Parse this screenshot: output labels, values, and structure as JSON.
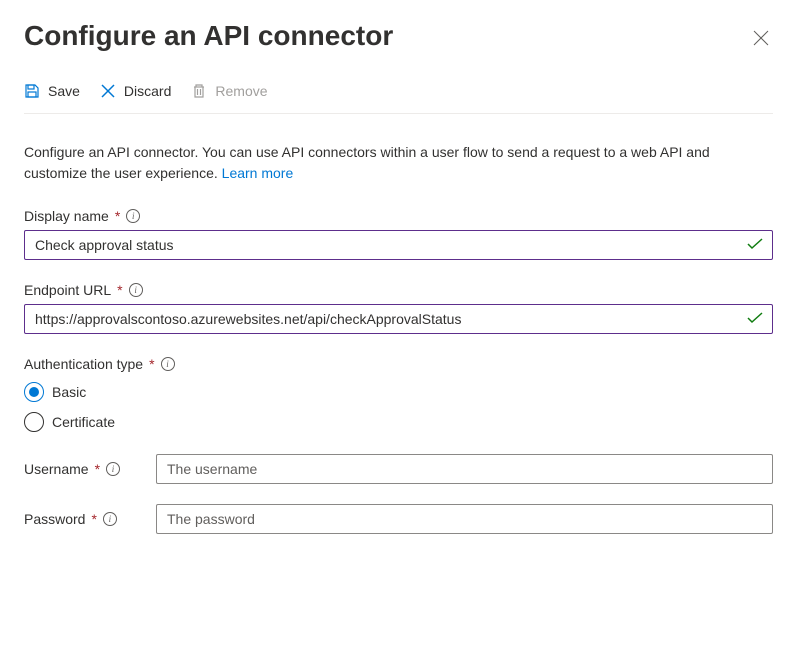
{
  "header": {
    "title": "Configure an API connector"
  },
  "toolbar": {
    "save": "Save",
    "discard": "Discard",
    "remove": "Remove"
  },
  "description": {
    "text": "Configure an API connector. You can use API connectors within a user flow to send a request to a web API and customize the user experience. ",
    "link": "Learn more"
  },
  "fields": {
    "displayName": {
      "label": "Display name",
      "value": "Check approval status"
    },
    "endpointUrl": {
      "label": "Endpoint URL",
      "value": "https://approvalscontoso.azurewebsites.net/api/checkApprovalStatus"
    },
    "authType": {
      "label": "Authentication type",
      "options": {
        "basic": "Basic",
        "certificate": "Certificate"
      },
      "selected": "basic"
    },
    "username": {
      "label": "Username",
      "placeholder": "The username"
    },
    "password": {
      "label": "Password",
      "placeholder": "The password"
    }
  }
}
